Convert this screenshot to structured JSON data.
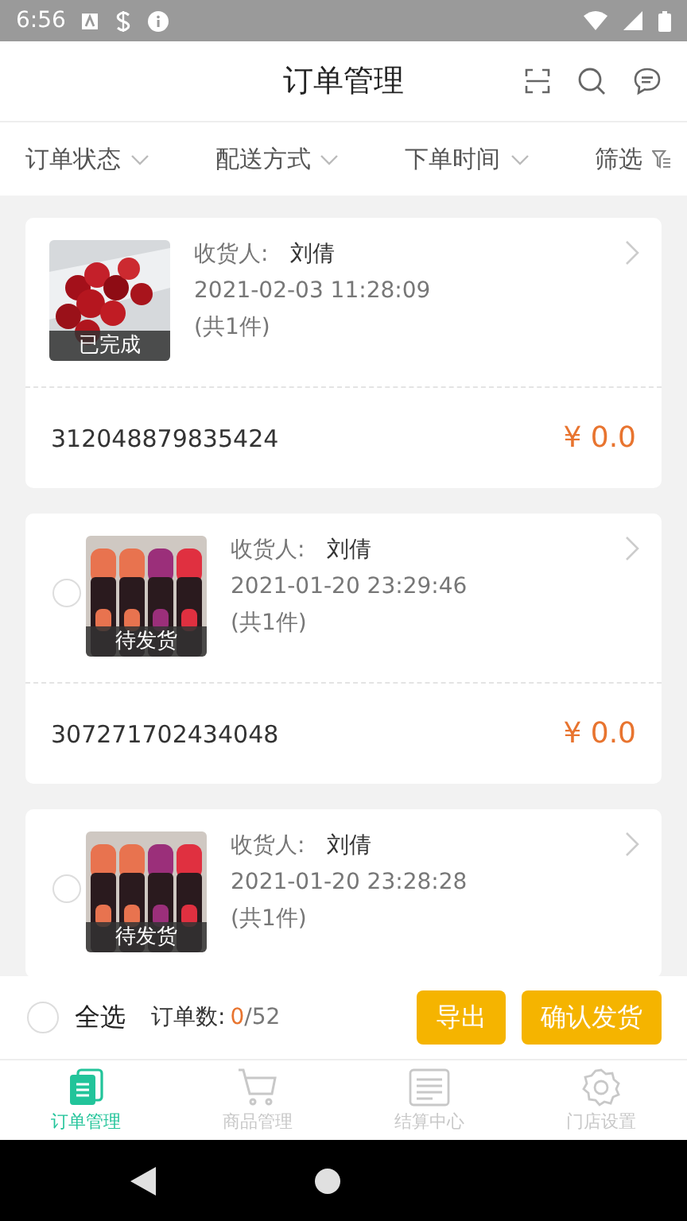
{
  "status_bar": {
    "time": "6:56"
  },
  "header": {
    "title": "订单管理"
  },
  "filters": [
    {
      "label": "订单状态",
      "kind": "dropdown"
    },
    {
      "label": "配送方式",
      "kind": "dropdown"
    },
    {
      "label": "下单时间",
      "kind": "dropdown"
    },
    {
      "label": "筛选",
      "kind": "filter"
    }
  ],
  "orders": [
    {
      "status": "已完成",
      "consignee_label": "收货人:",
      "consignee": "刘倩",
      "time": "2021-02-03 11:28:09",
      "count": "(共1件)",
      "order_no": "312048879835424",
      "price": "¥ 0.0"
    },
    {
      "status": "待发货",
      "consignee_label": "收货人:",
      "consignee": "刘倩",
      "time": "2021-01-20 23:29:46",
      "count": "(共1件)",
      "order_no": "307271702434048",
      "price": "¥ 0.0",
      "selected": false
    },
    {
      "status": "待发货",
      "consignee_label": "收货人:",
      "consignee": "刘倩",
      "time": "2021-01-20 23:28:28",
      "count": "(共1件)",
      "selected": false
    }
  ],
  "footer": {
    "select_all": "全选",
    "selected": false,
    "count_label": "订单数:",
    "count_selected": "0",
    "count_total": "/52",
    "buttons": [
      "导出",
      "确认发货"
    ]
  },
  "tabs": [
    {
      "label": "订单管理",
      "selected": true
    },
    {
      "label": "商品管理",
      "selected": false
    },
    {
      "label": "结算中心",
      "selected": false
    },
    {
      "label": "门店设置",
      "selected": false
    }
  ]
}
